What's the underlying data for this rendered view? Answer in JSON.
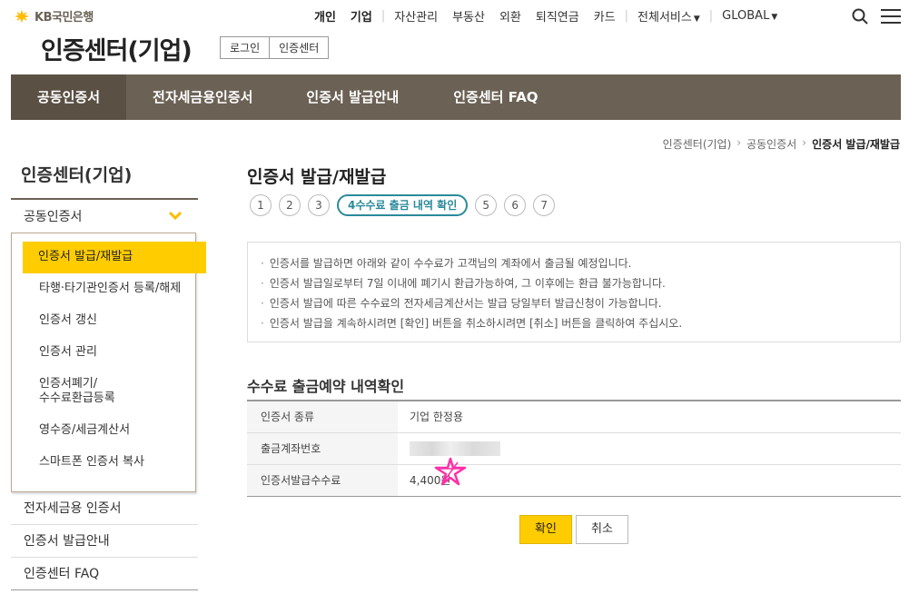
{
  "header": {
    "logo_text": "KB국민은행",
    "top_nav": [
      {
        "label": "개인",
        "strong": true
      },
      {
        "label": "기업",
        "strong": true
      },
      {
        "label": "자산관리"
      },
      {
        "label": "부동산"
      },
      {
        "label": "외환"
      },
      {
        "label": "퇴직연금"
      },
      {
        "label": "카드"
      },
      {
        "label": "전체서비스"
      },
      {
        "label": "GLOBAL"
      }
    ],
    "site_title": "인증센터(기업)",
    "site_links": [
      "로그인",
      "인증센터"
    ]
  },
  "main_nav": [
    "공동인증서",
    "전자세금용인증서",
    "인증서 발급안내",
    "인증센터 FAQ"
  ],
  "breadcrumb": [
    "인증센터(기업)",
    "공동인증서",
    "인증서 발급/재발급"
  ],
  "sidebar": {
    "title": "인증센터(기업)",
    "category": "공동인증서",
    "sub_items": [
      "인증서 발급/재발급",
      "타행·타기관인증서 등록/해제",
      "인증서 갱신",
      "인증서 관리",
      "인증서폐기/\n수수료환급등록",
      "영수증/세금계산서",
      "스마트폰 인증서 복사"
    ],
    "other_categories": [
      "전자세금용 인증서",
      "인증서 발급안내",
      "인증센터 FAQ"
    ]
  },
  "content": {
    "title": "인증서 발급/재발급",
    "steps": [
      "1",
      "2",
      "3",
      "4수수료 출금 내역 확인",
      "5",
      "6",
      "7"
    ],
    "notices": [
      "인증서를 발급하면 아래와 같이 수수료가 고객님의 계좌에서 출금될 예정입니다.",
      "인증서 발급일로부터 7일 이내에 폐기시 환급가능하여, 그 이후에는 환급 불가능합니다.",
      "인증서 발급에 따른 수수료의 전자세금계산서는 발급 당일부터 발급신청이 가능합니다.",
      "인증서 발급을 계속하시려면 [확인] 버튼을 취소하시려면 [취소] 버튼을 클릭하여 주십시오."
    ],
    "section_title": "수수료 출금예약 내역확인",
    "table": [
      {
        "label": "인증서 종류",
        "value": "기업 한정용"
      },
      {
        "label": "출금계좌번호",
        "value": ""
      },
      {
        "label": "인증서발급수수료",
        "value": "4,400원"
      }
    ],
    "confirm_label": "확인",
    "cancel_label": "취소"
  },
  "colors": {
    "brand_brown": "#6b6155",
    "brand_yellow": "#ffcc00",
    "step_accent": "#2a8a9a"
  }
}
